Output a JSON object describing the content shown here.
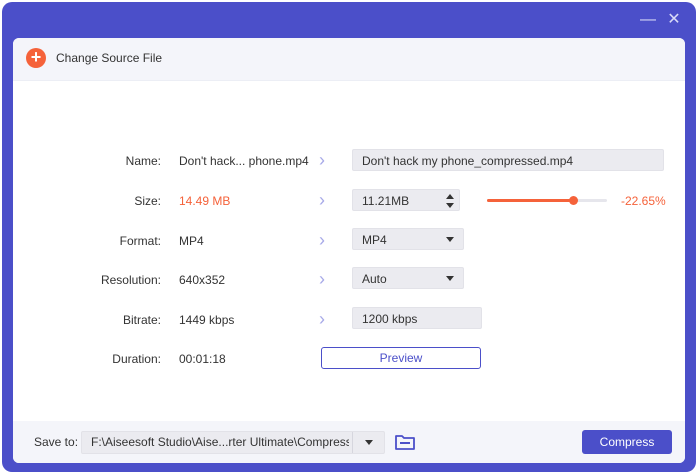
{
  "window": {
    "minimize_glyph": "—",
    "close_glyph": "✕"
  },
  "top_bar": {
    "add_icon": "plus-circle-icon",
    "add_glyph": "+",
    "label": "Change Source File"
  },
  "rows": {
    "name": {
      "label": "Name:",
      "source": "Don't hack... phone.mp4",
      "output": "Don't hack my phone_compressed.mp4"
    },
    "size": {
      "label": "Size:",
      "source": "14.49 MB",
      "output": "11.21MB",
      "slider_fraction": 0.72,
      "percent": "-22.65%"
    },
    "format": {
      "label": "Format:",
      "source": "MP4",
      "output": "MP4"
    },
    "resolution": {
      "label": "Resolution:",
      "source": "640x352",
      "output": "Auto"
    },
    "bitrate": {
      "label": "Bitrate:",
      "source": "1449 kbps",
      "output": "1200 kbps"
    },
    "duration": {
      "label": "Duration:",
      "source": "00:01:18"
    }
  },
  "arrow_glyph": "›",
  "preview_label": "Preview",
  "bottom_bar": {
    "save_label": "Save to:",
    "path": "F:\\Aiseesoft Studio\\Aise...rter Ultimate\\Compressed",
    "compress_label": "Compress"
  },
  "colors": {
    "accent": "#4b4fc9",
    "orange": "#f5623a"
  }
}
